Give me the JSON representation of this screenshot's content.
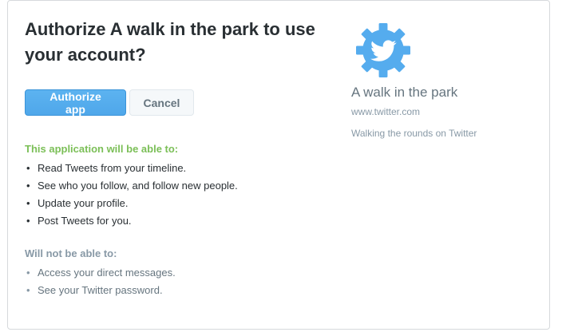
{
  "header": {
    "title": "Authorize A walk in the park to use your account?"
  },
  "actions": {
    "authorize_label": "Authorize app",
    "cancel_label": "Cancel"
  },
  "permissions": {
    "can_heading": "This application will be able to:",
    "can_items": [
      "Read Tweets from your timeline.",
      "See who you follow, and follow new people.",
      "Update your profile.",
      "Post Tweets for you."
    ],
    "cannot_heading": "Will not be able to:",
    "cannot_items": [
      "Access your direct messages.",
      "See your Twitter password."
    ]
  },
  "app": {
    "icon": "gear-twitter-bird-icon",
    "name": "A walk in the park",
    "url": "www.twitter.com",
    "description": "Walking the rounds on Twitter"
  },
  "colors": {
    "primary_button": "#55acee",
    "can_heading": "#7bbf57",
    "cannot_heading": "#8899a6",
    "icon": "#55acee"
  }
}
